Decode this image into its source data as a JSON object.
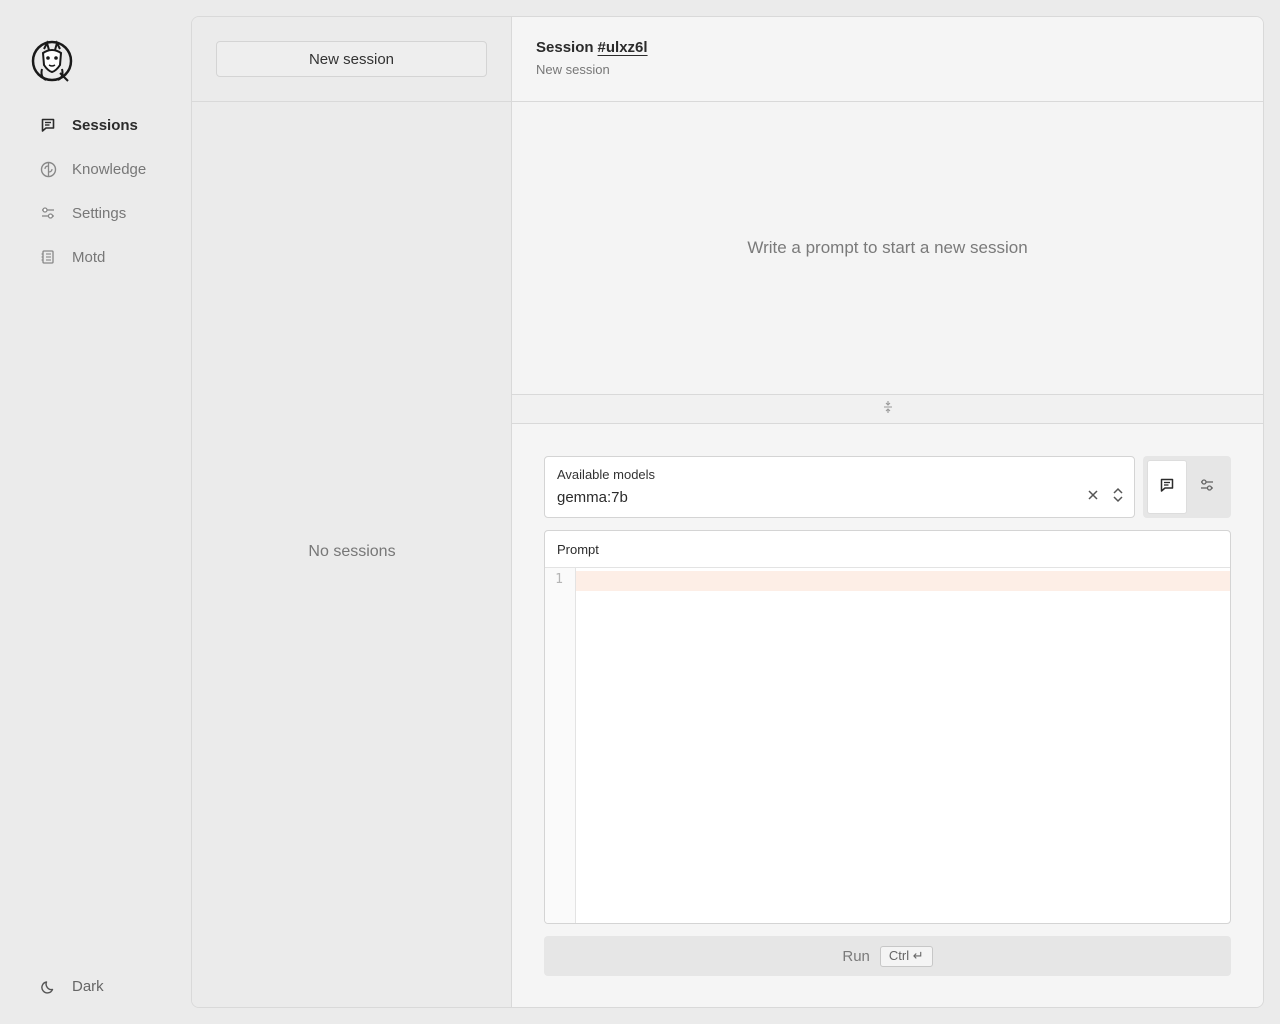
{
  "app": {
    "logo_icon": "llama-logo-icon"
  },
  "nav": {
    "items": [
      {
        "label": "Sessions",
        "icon": "chat-bubble-icon",
        "active": true
      },
      {
        "label": "Knowledge",
        "icon": "brain-icon",
        "active": false
      },
      {
        "label": "Settings",
        "icon": "sliders-icon",
        "active": false
      },
      {
        "label": "Motd",
        "icon": "notebook-icon",
        "active": false
      }
    ],
    "theme_toggle": {
      "label": "Dark",
      "icon": "moon-icon"
    }
  },
  "sessions": {
    "new_session_label": "New session",
    "empty_text": "No sessions"
  },
  "session": {
    "title_prefix": "Session",
    "id": "#ulxz6l",
    "subtitle": "New session",
    "empty_prompt": "Write a prompt to start a new session"
  },
  "composer": {
    "model_label": "Available models",
    "model_value": "gemma:7b",
    "prompt_label": "Prompt",
    "line_number": "1",
    "run_label": "Run",
    "run_shortcut": "Ctrl ↵"
  },
  "colors": {
    "background": "#ebebeb",
    "panel": "#f3f3f3",
    "active_line": "#fdeee6",
    "text": "#2b2b2b",
    "muted": "#777777"
  }
}
